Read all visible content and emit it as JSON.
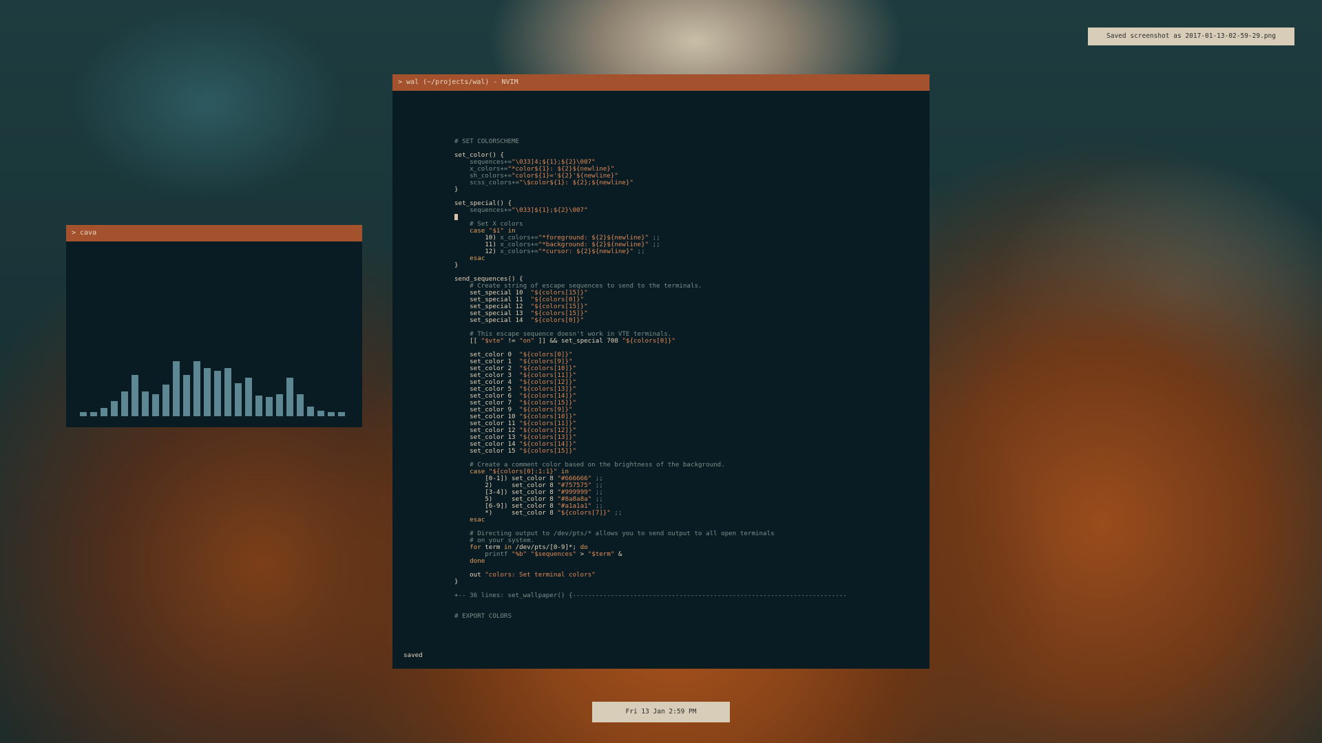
{
  "notification": {
    "text": "Saved screenshot as 2017-01-13-02-59-29.png"
  },
  "clock": {
    "text": "Fri 13 Jan  2:59 PM"
  },
  "nvim": {
    "title": "> wal (~/projects/wal) - NVIM",
    "status": "saved",
    "lines": [
      [
        [
          "# SET COLORSCHEME",
          "cmt"
        ]
      ],
      [],
      [
        [
          "set_color() {",
          "fn"
        ]
      ],
      [
        [
          "    sequences+=",
          "cmt"
        ],
        [
          "\"\\033]4;${1};${2}\\007\"",
          "str"
        ]
      ],
      [
        [
          "    x_colors+=",
          "cmt"
        ],
        [
          "\"*color${1}: ${2}${newline}\"",
          "str"
        ]
      ],
      [
        [
          "    sh_colors+=",
          "cmt"
        ],
        [
          "\"color${1}='${2}'${newline}\"",
          "str"
        ]
      ],
      [
        [
          "    scss_colors+=",
          "cmt"
        ],
        [
          "\"\\$color${1}: ${2};${newline}\"",
          "str"
        ]
      ],
      [
        [
          "}",
          "fn"
        ]
      ],
      [],
      [
        [
          "set_special() {",
          "fn"
        ]
      ],
      [
        [
          "    sequences+=",
          "cmt"
        ],
        [
          "\"\\033]${1};${2}\\007\"",
          "str"
        ]
      ],
      [
        [
          "CURSOR",
          "cursor"
        ]
      ],
      [
        [
          "    # Set X colors",
          "cmt"
        ]
      ],
      [
        [
          "    case ",
          "kw"
        ],
        [
          "\"$1\"",
          "str"
        ],
        [
          " in",
          "kw"
        ]
      ],
      [
        [
          "        10) ",
          "fn"
        ],
        [
          "x_colors+=",
          "cmt"
        ],
        [
          "\"*foreground: ${2}${newline}\"",
          "str"
        ],
        [
          " ;;",
          "cmt"
        ]
      ],
      [
        [
          "        11) ",
          "fn"
        ],
        [
          "x_colors+=",
          "cmt"
        ],
        [
          "\"*background: ${2}${newline}\"",
          "str"
        ],
        [
          " ;;",
          "cmt"
        ]
      ],
      [
        [
          "        12) ",
          "fn"
        ],
        [
          "x_colors+=",
          "cmt"
        ],
        [
          "\"*cursor: ${2}${newline}\"",
          "str"
        ],
        [
          " ;;",
          "cmt"
        ]
      ],
      [
        [
          "    esac",
          "kw"
        ]
      ],
      [
        [
          "}",
          "fn"
        ]
      ],
      [],
      [
        [
          "send_sequences() {",
          "fn"
        ]
      ],
      [
        [
          "    # Create string of escape sequences to send to the terminals.",
          "cmt"
        ]
      ],
      [
        [
          "    set_special 10  ",
          "fn"
        ],
        [
          "\"${colors[15]}\"",
          "str"
        ]
      ],
      [
        [
          "    set_special 11  ",
          "fn"
        ],
        [
          "\"${colors[0]}\"",
          "str"
        ]
      ],
      [
        [
          "    set_special 12  ",
          "fn"
        ],
        [
          "\"${colors[15]}\"",
          "str"
        ]
      ],
      [
        [
          "    set_special 13  ",
          "fn"
        ],
        [
          "\"${colors[15]}\"",
          "str"
        ]
      ],
      [
        [
          "    set_special 14  ",
          "fn"
        ],
        [
          "\"${colors[0]}\"",
          "str"
        ]
      ],
      [],
      [
        [
          "    # This escape sequence doesn't work in VTE terminals.",
          "cmt"
        ]
      ],
      [
        [
          "    [[ ",
          "fn"
        ],
        [
          "\"$vte\"",
          "str"
        ],
        [
          " != ",
          "fn"
        ],
        [
          "\"on\"",
          "str"
        ],
        [
          " ]] && set_special 708 ",
          "fn"
        ],
        [
          "\"${colors[0]}\"",
          "str"
        ]
      ],
      [],
      [
        [
          "    set_color 0  ",
          "fn"
        ],
        [
          "\"${colors[0]}\"",
          "str"
        ]
      ],
      [
        [
          "    set_color 1  ",
          "fn"
        ],
        [
          "\"${colors[9]}\"",
          "str"
        ]
      ],
      [
        [
          "    set_color 2  ",
          "fn"
        ],
        [
          "\"${colors[10]}\"",
          "str"
        ]
      ],
      [
        [
          "    set_color 3  ",
          "fn"
        ],
        [
          "\"${colors[11]}\"",
          "str"
        ]
      ],
      [
        [
          "    set_color 4  ",
          "fn"
        ],
        [
          "\"${colors[12]}\"",
          "str"
        ]
      ],
      [
        [
          "    set_color 5  ",
          "fn"
        ],
        [
          "\"${colors[13]}\"",
          "str"
        ]
      ],
      [
        [
          "    set_color 6  ",
          "fn"
        ],
        [
          "\"${colors[14]}\"",
          "str"
        ]
      ],
      [
        [
          "    set_color 7  ",
          "fn"
        ],
        [
          "\"${colors[15]}\"",
          "str"
        ]
      ],
      [
        [
          "    set_color 9  ",
          "fn"
        ],
        [
          "\"${colors[9]}\"",
          "str"
        ]
      ],
      [
        [
          "    set_color 10 ",
          "fn"
        ],
        [
          "\"${colors[10]}\"",
          "str"
        ]
      ],
      [
        [
          "    set_color 11 ",
          "fn"
        ],
        [
          "\"${colors[11]}\"",
          "str"
        ]
      ],
      [
        [
          "    set_color 12 ",
          "fn"
        ],
        [
          "\"${colors[12]}\"",
          "str"
        ]
      ],
      [
        [
          "    set_color 13 ",
          "fn"
        ],
        [
          "\"${colors[13]}\"",
          "str"
        ]
      ],
      [
        [
          "    set_color 14 ",
          "fn"
        ],
        [
          "\"${colors[14]}\"",
          "str"
        ]
      ],
      [
        [
          "    set_color 15 ",
          "fn"
        ],
        [
          "\"${colors[15]}\"",
          "str"
        ]
      ],
      [],
      [
        [
          "    # Create a comment color based on the brightness of the background.",
          "cmt"
        ]
      ],
      [
        [
          "    case ",
          "kw"
        ],
        [
          "\"${colors[0]:1:1}\"",
          "str"
        ],
        [
          " in",
          "kw"
        ]
      ],
      [
        [
          "        [0-1]) ",
          "fn"
        ],
        [
          "set_color 8 ",
          "fn"
        ],
        [
          "\"#666666\"",
          "str"
        ],
        [
          " ;;",
          "cmt"
        ]
      ],
      [
        [
          "        2)     ",
          "fn"
        ],
        [
          "set_color 8 ",
          "fn"
        ],
        [
          "\"#757575\"",
          "str"
        ],
        [
          " ;;",
          "cmt"
        ]
      ],
      [
        [
          "        [3-4]) ",
          "fn"
        ],
        [
          "set_color 8 ",
          "fn"
        ],
        [
          "\"#999999\"",
          "str"
        ],
        [
          " ;;",
          "cmt"
        ]
      ],
      [
        [
          "        5)     ",
          "fn"
        ],
        [
          "set_color 8 ",
          "fn"
        ],
        [
          "\"#8a8a8a\"",
          "str"
        ],
        [
          " ;;",
          "cmt"
        ]
      ],
      [
        [
          "        [6-9]) ",
          "fn"
        ],
        [
          "set_color 8 ",
          "fn"
        ],
        [
          "\"#a1a1a1\"",
          "str"
        ],
        [
          " ;;",
          "cmt"
        ]
      ],
      [
        [
          "        *)     ",
          "fn"
        ],
        [
          "set_color 8 ",
          "fn"
        ],
        [
          "\"${colors[7]}\"",
          "str"
        ],
        [
          " ;;",
          "cmt"
        ]
      ],
      [
        [
          "    esac",
          "kw"
        ]
      ],
      [],
      [
        [
          "    # Directing output to /dev/pts/* allows you to send output to all open terminals",
          "cmt"
        ]
      ],
      [
        [
          "    # on your system.",
          "cmt"
        ]
      ],
      [
        [
          "    for ",
          "kw"
        ],
        [
          "term ",
          "fn"
        ],
        [
          "in ",
          "kw"
        ],
        [
          "/dev/pts/[0-9]*; ",
          "fn"
        ],
        [
          "do",
          "kw"
        ]
      ],
      [
        [
          "        printf ",
          "cmt"
        ],
        [
          "\"%b\"",
          "str"
        ],
        [
          " \"$sequences\"",
          "str"
        ],
        [
          " > ",
          "fn"
        ],
        [
          "\"$term\"",
          "str"
        ],
        [
          " &",
          "fn"
        ]
      ],
      [
        [
          "    done",
          "kw"
        ]
      ],
      [],
      [
        [
          "    out ",
          "fn"
        ],
        [
          "\"colors: Set terminal colors\"",
          "str"
        ]
      ],
      [
        [
          "}",
          "fn"
        ]
      ],
      [],
      [
        [
          "+-- 36 lines: set_wallpaper() {------------------------------------------------------------------------",
          "cmt"
        ]
      ],
      [],
      [],
      [
        [
          "# EXPORT COLORS",
          "cmt"
        ]
      ]
    ]
  },
  "cava": {
    "title": "> cava",
    "levels": [
      0.05,
      0.05,
      0.1,
      0.18,
      0.3,
      0.5,
      0.3,
      0.27,
      0.38,
      0.67,
      0.5,
      0.67,
      0.58,
      0.55,
      0.58,
      0.4,
      0.47,
      0.25,
      0.23,
      0.27,
      0.47,
      0.27,
      0.12,
      0.07,
      0.05,
      0.05
    ]
  },
  "colors": {
    "titlebar": "#a4522e",
    "terminal_bg": "#0a1c23",
    "bar": "#5c8793",
    "panel": "#d8cdb8"
  }
}
